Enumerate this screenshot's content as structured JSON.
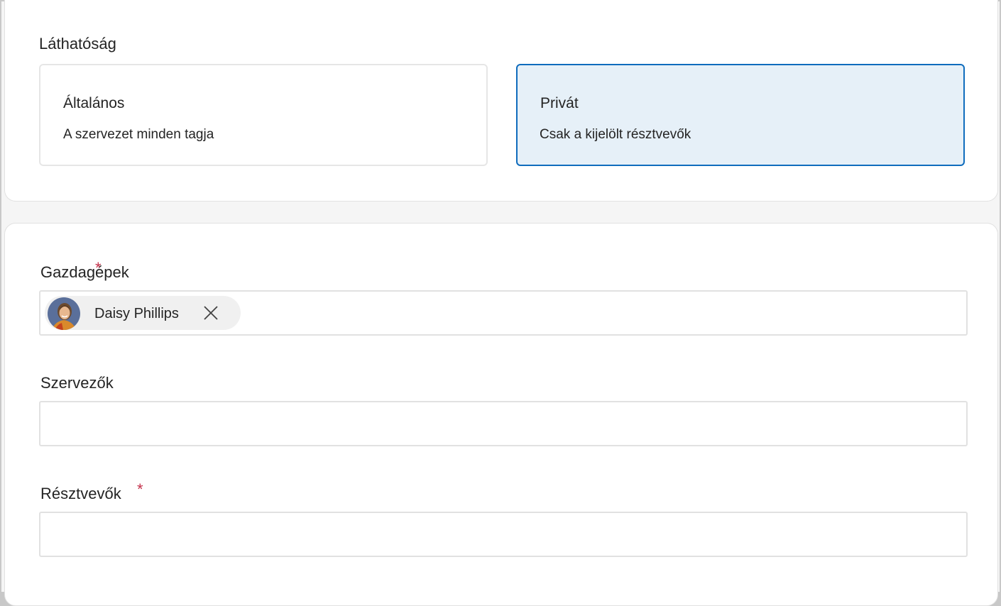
{
  "visibility": {
    "label": "Láthatóság",
    "options": [
      {
        "title": "Általános",
        "description": "A szervezet minden tagja",
        "selected": false
      },
      {
        "title": "Privát",
        "description": "Csak a kijelölt résztvevők",
        "selected": true
      }
    ]
  },
  "hosts": {
    "label": "Gazdagépek",
    "required_marker": "*",
    "chips": [
      {
        "name": "Daisy Phillips"
      }
    ]
  },
  "organizers": {
    "label": "Szervezők",
    "value": ""
  },
  "attendees": {
    "label": "Résztvevők",
    "required_marker": "*",
    "value": ""
  },
  "colors": {
    "accent": "#0f6cbd",
    "selected_bg": "#e6f0f8",
    "required": "#c4314b"
  }
}
